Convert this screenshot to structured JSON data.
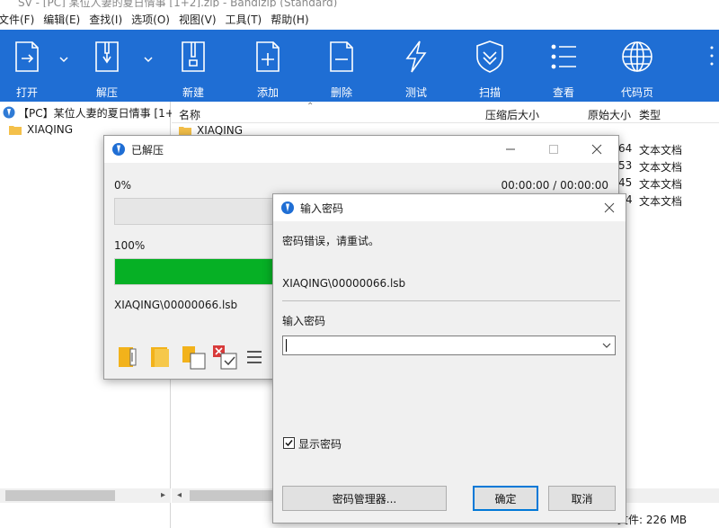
{
  "app": {
    "title_fragment": "SV - [PC] 某位人妻的夏日情事 [1+2].zip - Bandizip (Standard)"
  },
  "menu": [
    "文件(F)",
    "编辑(E)",
    "查找(I)",
    "选项(O)",
    "视图(V)",
    "工具(T)",
    "帮助(H)"
  ],
  "toolbar": {
    "open": "打开",
    "extract": "解压",
    "new": "新建",
    "add": "添加",
    "delete": "删除",
    "test": "测试",
    "scan": "扫描",
    "view": "查看",
    "codepage": "代码页"
  },
  "tree": {
    "root": "【PC】某位人妻的夏日情事 [1+2",
    "child": "XIAQING"
  },
  "filelist": {
    "col_name": "名称",
    "col_packed": "压缩后大小",
    "col_size": "原始大小",
    "col_type": "类型",
    "first_row_name": "XIAQING",
    "rows": [
      {
        "size_tail": "64",
        "type": "文本文档"
      },
      {
        "size_tail": "53",
        "type": "文本文档"
      },
      {
        "size_tail": "45",
        "type": "文本文档"
      },
      {
        "size_tail": "4",
        "type": "文本文档"
      }
    ],
    "status_tail": "文件: 226 MB"
  },
  "extract_dialog": {
    "title": "已解压",
    "file_progress_label": "0%",
    "time": "00:00:00 / 00:00:00",
    "total_progress_label": "100%",
    "file_progress": 0,
    "total_progress": 100,
    "current_file": "XIAQING\\00000066.lsb"
  },
  "password_dialog": {
    "title": "输入密码",
    "error_message": "密码错误，请重试。",
    "file_path": "XIAQING\\00000066.lsb",
    "input_label": "输入密码",
    "input_value": "",
    "show_password_label": "显示密码",
    "show_password_checked": true,
    "manager_button": "密码管理器...",
    "ok_button": "确定",
    "cancel_button": "取消"
  },
  "colors": {
    "toolbar_bg": "#1f6ed4",
    "progress_green": "#06b025",
    "accent_blue": "#0078d7"
  }
}
